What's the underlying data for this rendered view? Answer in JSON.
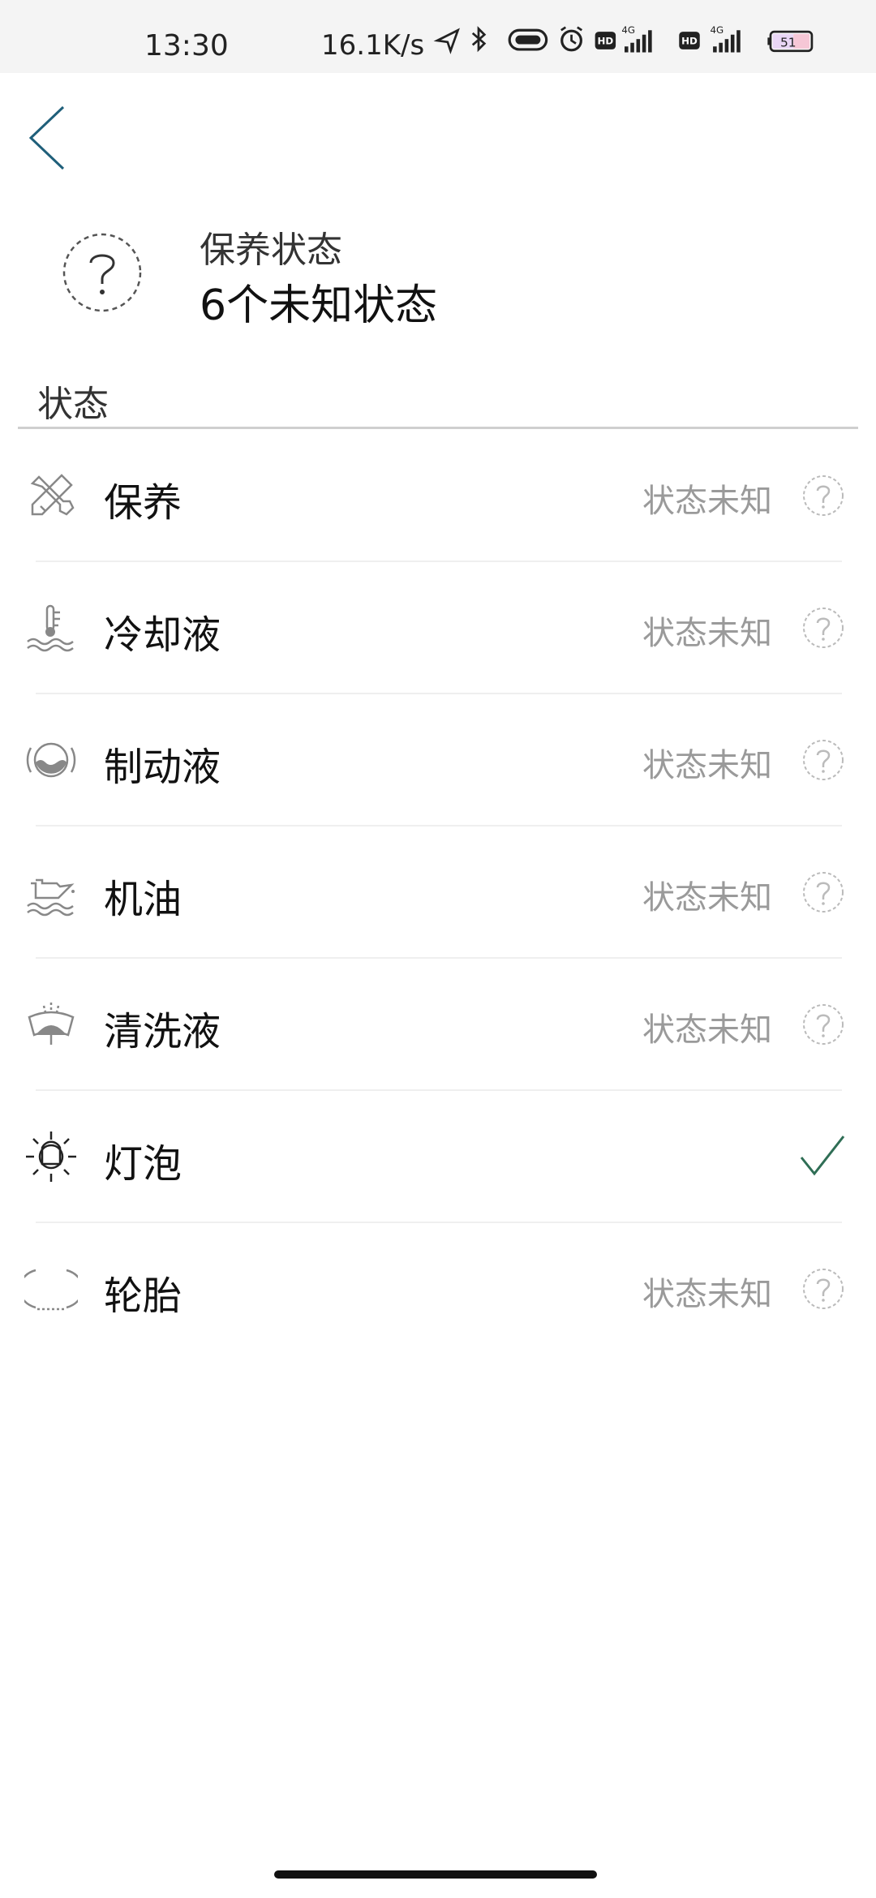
{
  "status_bar": {
    "time": "13:30",
    "speed": "16.1K/s",
    "battery": "51",
    "network_1": "4G",
    "network_2": "4G",
    "hd_badge": "HD"
  },
  "header": {
    "icon": "question-circle-icon",
    "title": "保养状态",
    "subtitle": "6个未知状态"
  },
  "section": {
    "label": "状态"
  },
  "items": [
    {
      "icon": "wrench-screwdriver-icon",
      "label": "保养",
      "state": "状态未知",
      "status": "unknown"
    },
    {
      "icon": "coolant-icon",
      "label": "冷却液",
      "state": "状态未知",
      "status": "unknown"
    },
    {
      "icon": "brake-fluid-icon",
      "label": "制动液",
      "state": "状态未知",
      "status": "unknown"
    },
    {
      "icon": "oil-can-icon",
      "label": "机油",
      "state": "状态未知",
      "status": "unknown"
    },
    {
      "icon": "washer-fluid-icon",
      "label": "清洗液",
      "state": "状态未知",
      "status": "unknown"
    },
    {
      "icon": "bulb-icon",
      "label": "灯泡",
      "state": "",
      "status": "ok"
    },
    {
      "icon": "tire-icon",
      "label": "轮胎",
      "state": "状态未知",
      "status": "unknown"
    }
  ],
  "colors": {
    "accent": "#1f5f7a",
    "ok_check": "#2f6e55",
    "muted": "#9a9a9a"
  }
}
